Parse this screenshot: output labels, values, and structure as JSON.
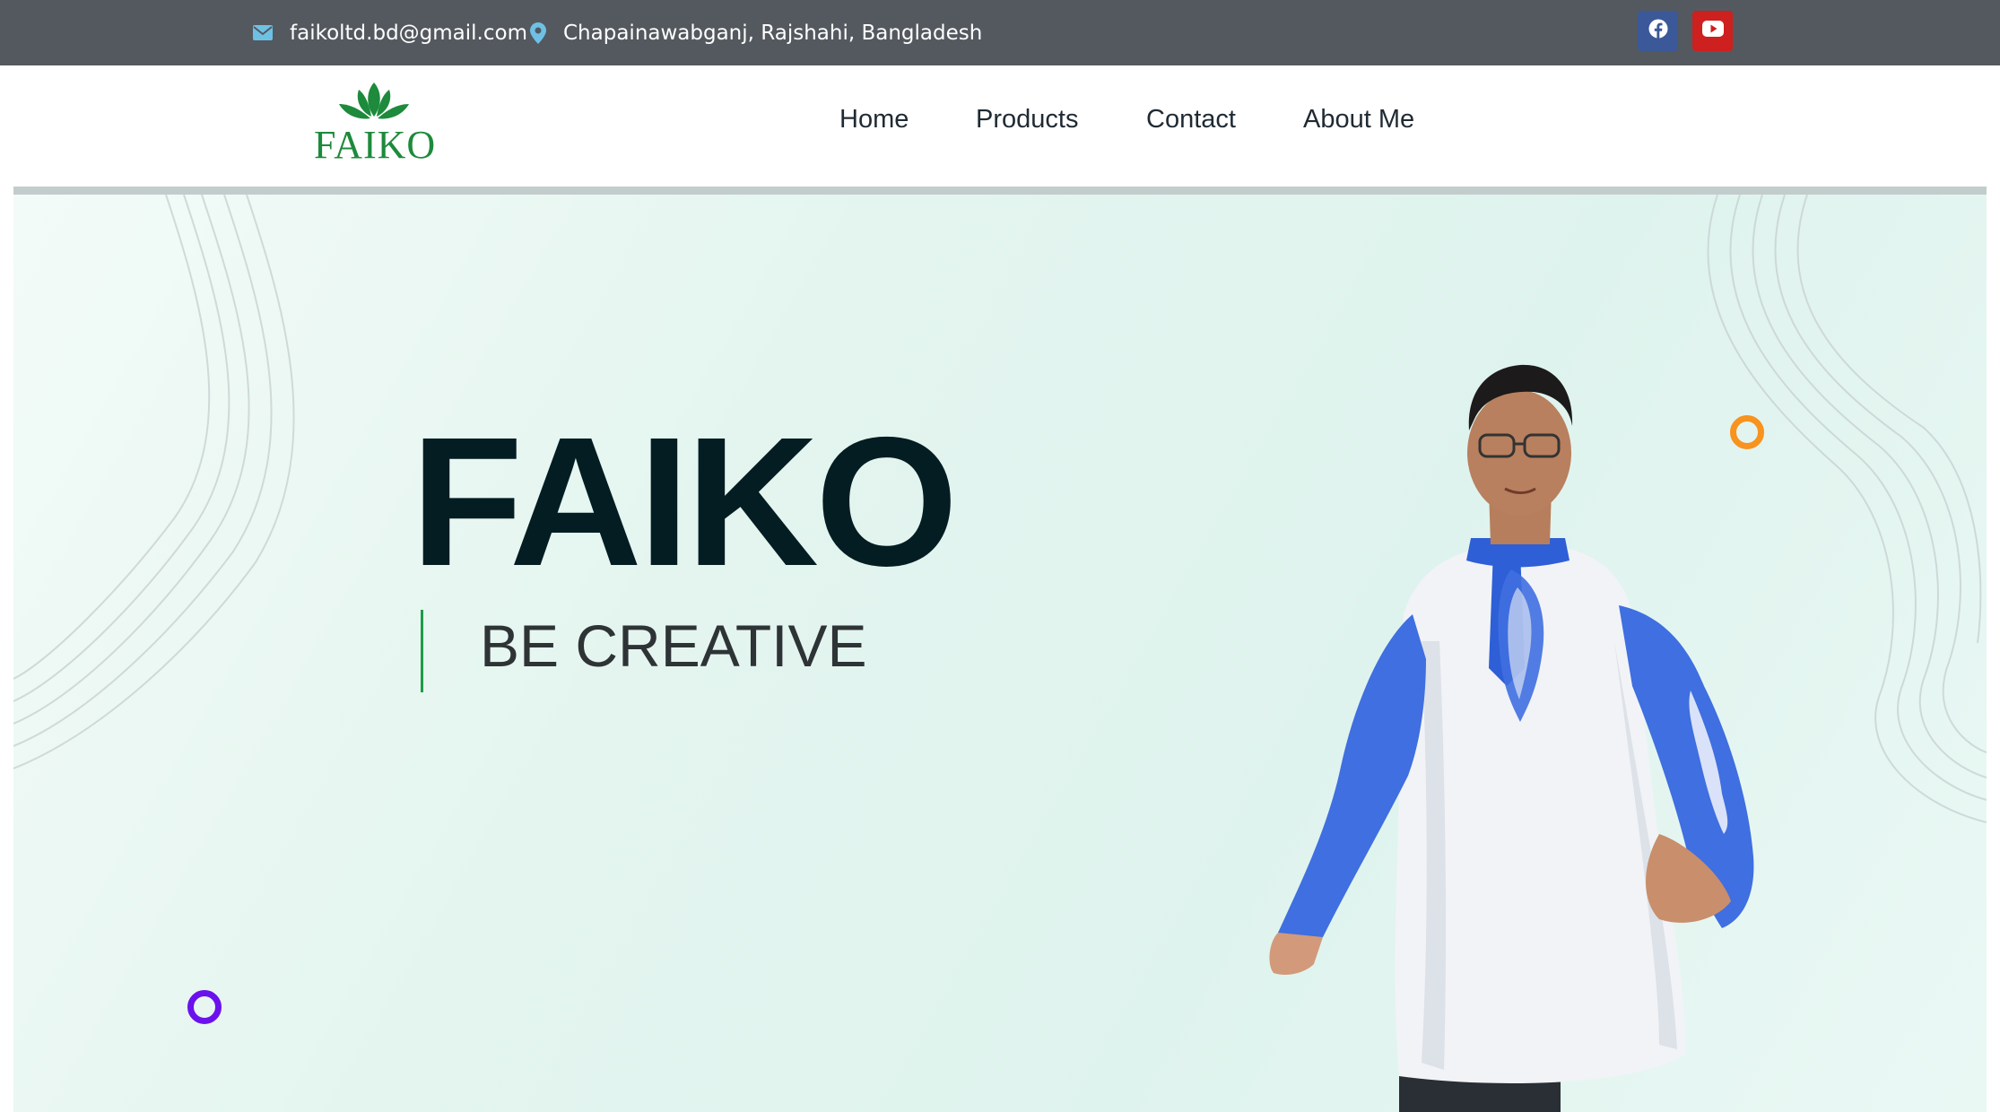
{
  "topbar": {
    "email": "faikoltd.bd@gmail.com",
    "email_icon": "envelope-icon",
    "location": "Chapainawabganj, Rajshahi, Bangladesh",
    "location_icon": "map-pin-icon",
    "social": [
      {
        "name": "facebook-icon",
        "color": "#3b5998"
      },
      {
        "name": "youtube-icon",
        "color": "#cd201f"
      }
    ],
    "background": "#54595f"
  },
  "header": {
    "logo_text": "FAIKO",
    "logo_icon": "lotus-leaves-icon",
    "nav": {
      "home": "Home",
      "products": "Products",
      "contact": "Contact",
      "about": "About Me"
    }
  },
  "hero": {
    "title": "FAIKO",
    "tagline": "BE CREATIVE",
    "image": "man-in-white-and-blue-kurta",
    "accent_colors": {
      "green": "#1f9b4a",
      "orange": "#f7931e",
      "purple": "#6b11ee",
      "title": "#031d22"
    }
  }
}
